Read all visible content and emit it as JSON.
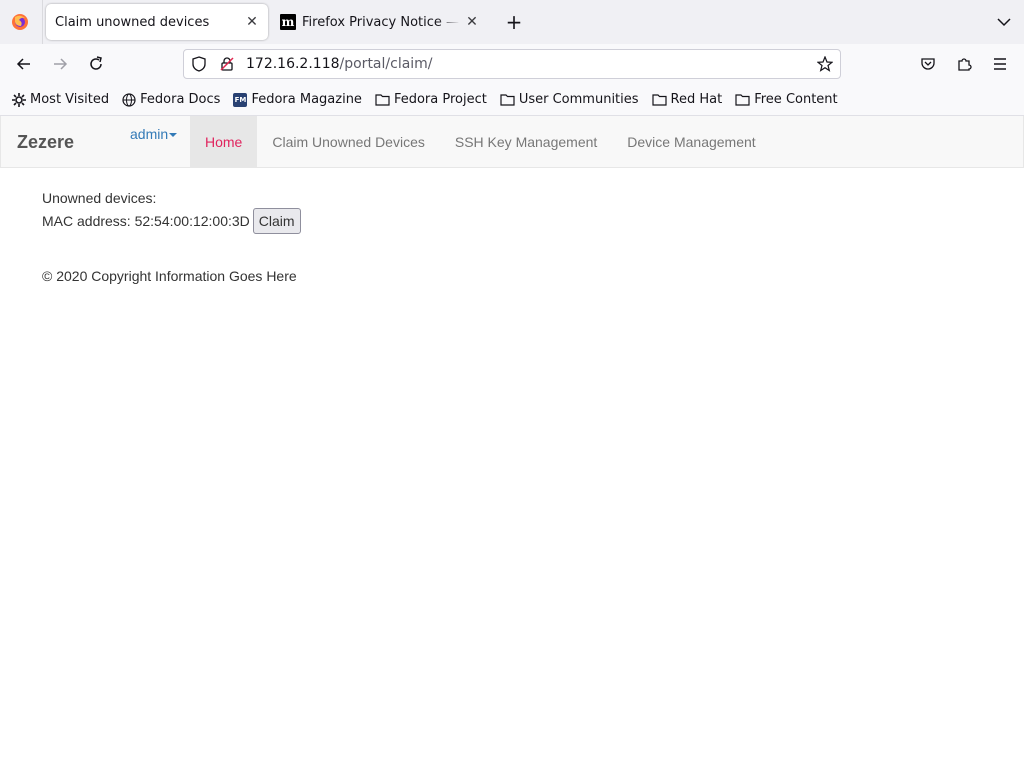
{
  "browser": {
    "tabs": [
      {
        "title": "Claim unowned devices",
        "active": true
      },
      {
        "title": "Firefox Privacy Notice — Mozilla",
        "active": false
      }
    ],
    "url": {
      "host": "172.16.2.118",
      "path": "/portal/claim/"
    },
    "bookmarks": [
      {
        "label": "Most Visited",
        "icon": "gear-icon"
      },
      {
        "label": "Fedora Docs",
        "icon": "globe-icon"
      },
      {
        "label": "Fedora Magazine",
        "icon": "fedora-magazine-icon"
      },
      {
        "label": "Fedora Project",
        "icon": "folder-icon"
      },
      {
        "label": "User Communities",
        "icon": "folder-icon"
      },
      {
        "label": "Red Hat",
        "icon": "folder-icon"
      },
      {
        "label": "Free Content",
        "icon": "folder-icon"
      }
    ]
  },
  "site": {
    "brand": "Zezere",
    "user": "admin",
    "nav": [
      {
        "label": "Home",
        "active": true
      },
      {
        "label": "Claim Unowned Devices",
        "active": false
      },
      {
        "label": "SSH Key Management",
        "active": false
      },
      {
        "label": "Device Management",
        "active": false
      }
    ],
    "heading": "Unowned devices:",
    "devices": [
      {
        "mac_label": "MAC address: 52:54:00:12:00:3D",
        "button": "Claim"
      }
    ],
    "footer": "© 2020 Copyright Information Goes Here"
  },
  "colors": {
    "active_nav": "#e0245e",
    "link": "#337ab7"
  }
}
